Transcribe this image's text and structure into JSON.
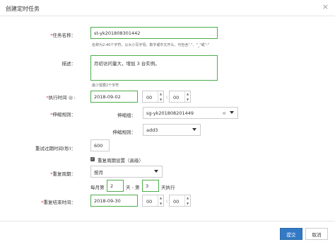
{
  "dialog": {
    "title": "创建定时任务",
    "close_icon": "×"
  },
  "task_name": {
    "label": "任务名称：",
    "value": "st-yk201808301442",
    "hint": "名称为2-40个字符，以大小写字母，数字或中文开头，可包含\".\"、\"_\"或\"-\""
  },
  "description": {
    "label": "描述：",
    "value": "月初访问量大，增加 3 台实例。",
    "hint": "最少需要2个字符"
  },
  "exec_time": {
    "label": "执行时间",
    "date": "2018-09-02",
    "hour": "00",
    "minute": "00"
  },
  "scale_rule": {
    "label": "伸缩规则：",
    "group_label": "伸缩组：",
    "group_value": "sg-yk201808201449",
    "group_clear_icon": "⊗",
    "rule_label": "伸缩规则：",
    "rule_value": "add3"
  },
  "retry": {
    "label": "重试过期时间(秒)：",
    "value": "600"
  },
  "repeat_settings": {
    "checkbox_label": "重复周期设置（高级）"
  },
  "repeat_period": {
    "label": "重复周期：",
    "value": "按月"
  },
  "monthly": {
    "prefix": "每月第",
    "from": "2",
    "mid": "天 - 第",
    "to": "3",
    "suffix": "天执行"
  },
  "repeat_end": {
    "label": "重复结束时间：",
    "date": "2018-09-30",
    "hour": "00",
    "minute": "00"
  },
  "buttons": {
    "submit": "提交",
    "cancel": "取消"
  },
  "required_mark": "*",
  "help_icon": "?",
  "colon": ":",
  "spinner_up": "▲",
  "spinner_down": "▼",
  "checkbox_mark": "✓"
}
